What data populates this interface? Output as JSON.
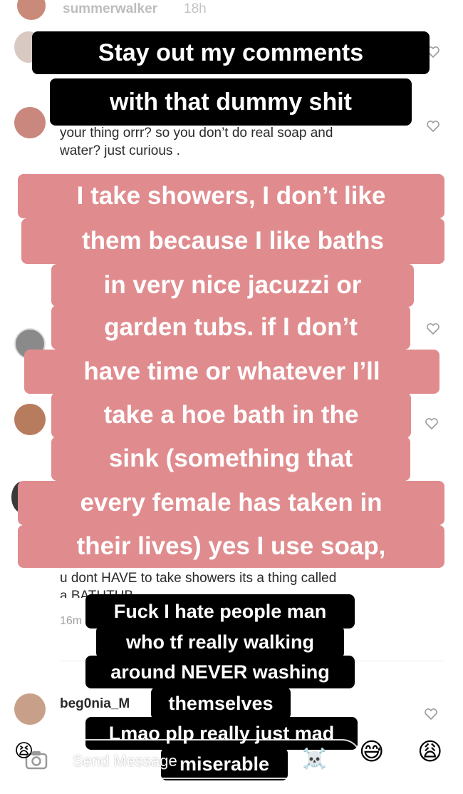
{
  "story": {
    "username": "summerwalker",
    "time": "18h"
  },
  "comments": [
    {
      "text": "your thing orrr? so you don’t do real soap and\nwater? just curious ."
    },
    {
      "text": "u dont HAVE to take showers its a thing called\na BATHTUB"
    },
    {
      "meta": "16m"
    },
    {
      "username": "beg0nia_M"
    }
  ],
  "stickers": {
    "top": [
      "Stay out my comments",
      "with that dummy shit"
    ],
    "pink": [
      "I take showers, I don’t like",
      "them because I like baths",
      "in very nice jacuzzi or",
      "garden tubs. if I don’t",
      "have time or whatever I’ll",
      "take a hoe bath in the",
      "sink (something that",
      "every female has taken in",
      "their lives) yes I use soap,"
    ],
    "bottom": [
      "Fuck I hate people man",
      "who tf really walking",
      "around NEVER washing",
      "themselves",
      "Lmao plp really just mad",
      "miserable"
    ]
  },
  "reply_bar": {
    "placeholder": "Send Message",
    "emoji_left": "😫",
    "emoji_skull": "☠️",
    "emoji_sweat": "😅",
    "emoji_weary": "😩"
  },
  "colors": {
    "sticker_black": "#000000",
    "sticker_pink": "#e08c8f",
    "comment_text": "#2a2a2a",
    "meta_gray": "#a0a0a0"
  },
  "icons": [
    "close-icon",
    "heart-outline-icon",
    "camera-icon",
    "send-icon"
  ]
}
